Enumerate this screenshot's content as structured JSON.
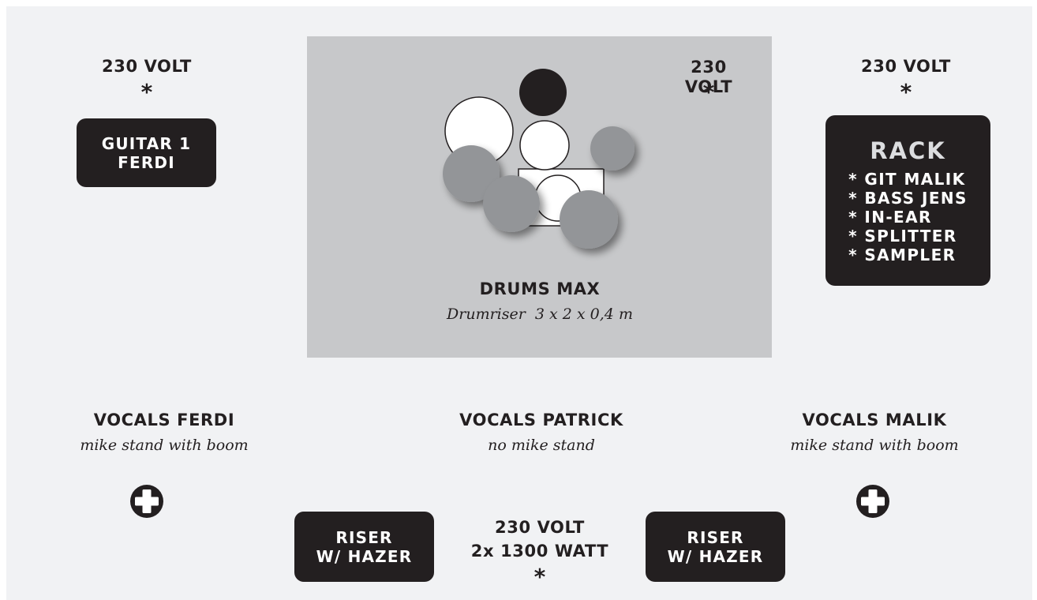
{
  "power_top_left": {
    "label": "230 VOLT",
    "marker": "*"
  },
  "power_top_center": {
    "label": "230 VOLT",
    "marker": "*"
  },
  "power_top_right": {
    "label": "230 VOLT",
    "marker": "*"
  },
  "guitar_box": {
    "line1": "GUITAR 1",
    "line2": "FERDI"
  },
  "rack": {
    "title": "RACK",
    "items": [
      "* GIT MALIK",
      "* BASS JENS",
      "* IN-EAR",
      "* SPLITTER",
      "* SAMPLER"
    ]
  },
  "drums": {
    "title": "DRUMS MAX",
    "subtitle": "Drumriser  3 x 2 x 0,4 m"
  },
  "vocals_left": {
    "title": "VOCALS FERDI",
    "note": "mike stand with boom",
    "icon": "mic-stand-plus-icon"
  },
  "vocals_center": {
    "title": "VOCALS PATRICK",
    "note": "no mike stand"
  },
  "vocals_right": {
    "title": "VOCALS MALIK",
    "note": "mike stand with boom",
    "icon": "mic-stand-plus-icon"
  },
  "riser_left": {
    "line1": "RISER",
    "line2": "W/ HAZER"
  },
  "riser_right": {
    "line1": "RISER",
    "line2": "W/ HAZER"
  },
  "power_bottom": {
    "line1": "230 VOLT",
    "line2": "2x 1300 WATT",
    "marker": "*"
  },
  "colors": {
    "background": "#f1f2f4",
    "riser_area": "#c7c8ca",
    "box_fill": "#231f20",
    "box_text": "#ffffff",
    "drum_white": "#ffffff",
    "drum_gray": "#939598",
    "drum_black": "#231f20"
  }
}
